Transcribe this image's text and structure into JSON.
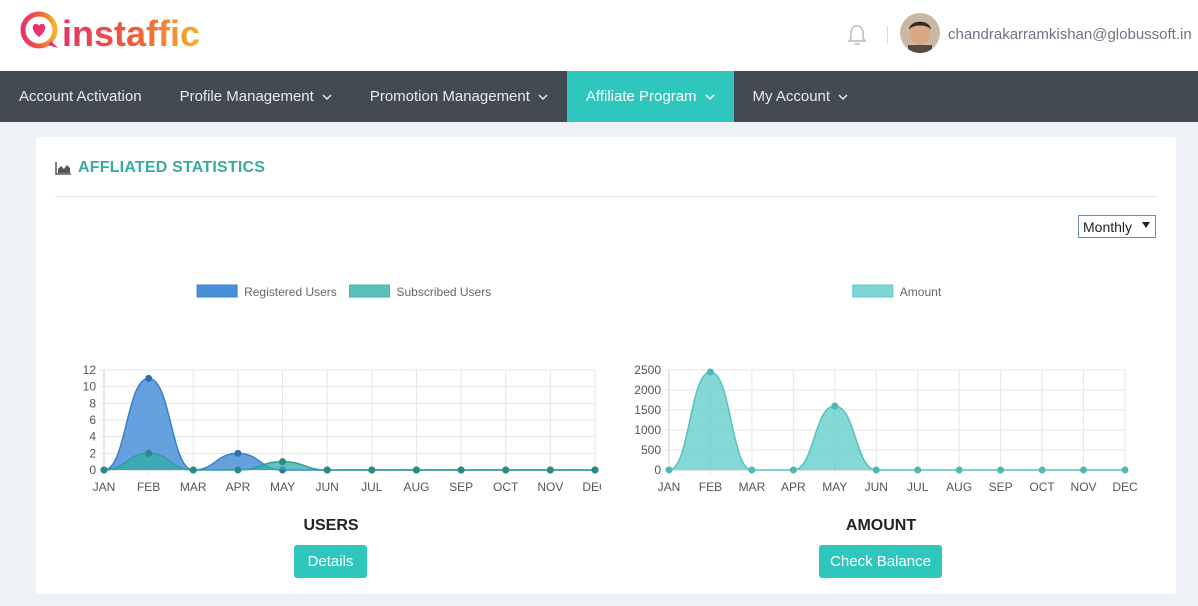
{
  "header": {
    "brand_name": "instaffic",
    "user_email": "chandrakarramkishan@globussoft.in"
  },
  "nav": {
    "items": [
      {
        "label": "Account Activation",
        "has_dropdown": false,
        "active": false
      },
      {
        "label": "Profile Management",
        "has_dropdown": true,
        "active": false
      },
      {
        "label": "Promotion Management",
        "has_dropdown": true,
        "active": false
      },
      {
        "label": "Affiliate Program",
        "has_dropdown": true,
        "active": true
      },
      {
        "label": "My Account",
        "has_dropdown": true,
        "active": false
      }
    ]
  },
  "main": {
    "section_title": "AFFLIATED STATISTICS",
    "period_select": {
      "value": "Monthly"
    },
    "users_caption": "USERS",
    "details_button": "Details",
    "amount_caption": "AMOUNT",
    "check_balance_button": "Check Balance"
  },
  "colors": {
    "accent": "#2fc6be",
    "nav_bg": "#434a54",
    "registered": "#4a90d9",
    "subscribed": "#3fb5ad",
    "amount": "#5bcbc8",
    "title": "#3aaa9f"
  },
  "chart_data": [
    {
      "type": "area",
      "categories": [
        "JAN",
        "FEB",
        "MAR",
        "APR",
        "MAY",
        "JUN",
        "JUL",
        "AUG",
        "SEP",
        "OCT",
        "NOV",
        "DEC"
      ],
      "series": [
        {
          "name": "Registered Users",
          "values": [
            0,
            11,
            0,
            2,
            0,
            0,
            0,
            0,
            0,
            0,
            0,
            0
          ]
        },
        {
          "name": "Subscribed Users",
          "values": [
            0,
            2,
            0,
            0,
            1,
            0,
            0,
            0,
            0,
            0,
            0,
            0
          ]
        }
      ],
      "ylim": [
        0,
        12
      ],
      "yticks": [
        0,
        2,
        4,
        6,
        8,
        10,
        12
      ],
      "legend": "top",
      "grid": true
    },
    {
      "type": "area",
      "categories": [
        "JAN",
        "FEB",
        "MAR",
        "APR",
        "MAY",
        "JUN",
        "JUL",
        "AUG",
        "SEP",
        "OCT",
        "NOV",
        "DEC"
      ],
      "series": [
        {
          "name": "Amount",
          "values": [
            0,
            2450,
            0,
            0,
            1600,
            0,
            0,
            0,
            0,
            0,
            0,
            0
          ]
        }
      ],
      "ylim": [
        0,
        2500
      ],
      "yticks": [
        0,
        500,
        1000,
        1500,
        2000,
        2500
      ],
      "legend": "top",
      "grid": true
    }
  ]
}
